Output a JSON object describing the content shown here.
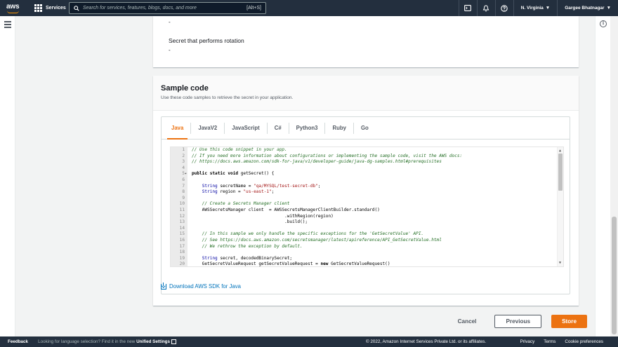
{
  "topnav": {
    "logo": "aws",
    "services_label": "Services",
    "search_placeholder": "Search for services, features, blogs, docs, and more",
    "search_shortcut": "[Alt+S]",
    "region": "N. Virginia",
    "user": "Gargee Bhatnagar"
  },
  "rotation_section": {
    "dash_top": "-",
    "label": "Secret that performs rotation",
    "value": "-"
  },
  "sample_code": {
    "title": "Sample code",
    "description": "Use these code samples to retrieve the secret in your application.",
    "tabs": [
      "Java",
      "JavaV2",
      "JavaScript",
      "C#",
      "Python3",
      "Ruby",
      "Go"
    ],
    "active_tab": "Java",
    "download_link": "Download AWS SDK for Java",
    "code_lines": [
      {
        "n": "1",
        "text": "// Use this code snippet in your app."
      },
      {
        "n": "2",
        "text": "// If you need more information about configurations or implementing the sample code, visit the AWS docs:"
      },
      {
        "n": "3",
        "text": "// https://docs.aws.amazon.com/sdk-for-java/v1/developer-guide/java-dg-samples.html#prerequisites"
      },
      {
        "n": "4",
        "text": ""
      },
      {
        "n": "5",
        "text": "public static void getSecret() {"
      },
      {
        "n": "6",
        "text": ""
      },
      {
        "n": "7",
        "text": "    String secretName = \"qa/MYSQL/test-secret-db\";"
      },
      {
        "n": "8",
        "text": "    String region = \"us-east-1\";"
      },
      {
        "n": "9",
        "text": ""
      },
      {
        "n": "10",
        "text": "    // Create a Secrets Manager client"
      },
      {
        "n": "11",
        "text": "    AWSSecretsManager client  = AWSSecretsManagerClientBuilder.standard()"
      },
      {
        "n": "12",
        "text": "                                    .withRegion(region)"
      },
      {
        "n": "13",
        "text": "                                    .build();"
      },
      {
        "n": "14",
        "text": ""
      },
      {
        "n": "15",
        "text": "    // In this sample we only handle the specific exceptions for the 'GetSecretValue' API."
      },
      {
        "n": "16",
        "text": "    // See https://docs.aws.amazon.com/secretsmanager/latest/apireference/API_GetSecretValue.html"
      },
      {
        "n": "17",
        "text": "    // We rethrow the exception by default."
      },
      {
        "n": "18",
        "text": ""
      },
      {
        "n": "19",
        "text": "    String secret, decodedBinarySecret;"
      },
      {
        "n": "20",
        "text": "    GetSecretValueRequest getSecretValueRequest = new GetSecretValueRequest()"
      }
    ]
  },
  "actions": {
    "cancel": "Cancel",
    "previous": "Previous",
    "store": "Store"
  },
  "footer": {
    "feedback": "Feedback",
    "hint_prefix": "Looking for language selection? Find it in the new ",
    "hint_link": "Unified Settings",
    "copyright": "© 2022, Amazon Internet Services Private Ltd. or its affiliates.",
    "privacy": "Privacy",
    "terms": "Terms",
    "cookies": "Cookie preferences"
  },
  "colors": {
    "nav_bg": "#232f3e",
    "accent": "#ec7211",
    "link": "#0073bb"
  }
}
